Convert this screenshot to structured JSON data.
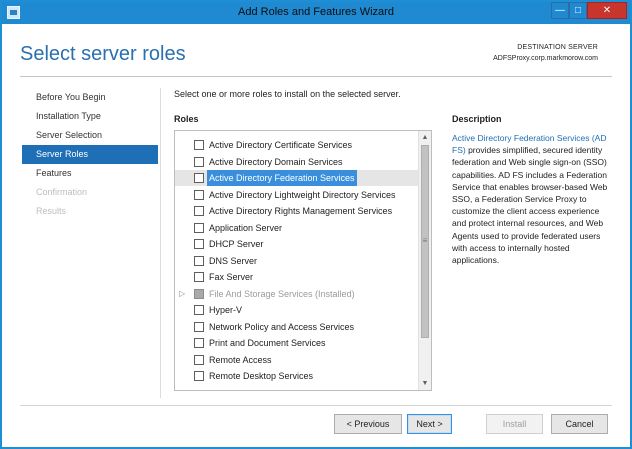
{
  "window": {
    "title": "Add Roles and Features Wizard",
    "controls": {
      "minimize": "—",
      "maximize": "□",
      "close": "✕"
    },
    "accent_color": "#1f8ad2"
  },
  "header": {
    "title": "Select server roles",
    "destination_label": "DESTINATION SERVER",
    "destination_server": "ADFSProxy.corp.markmorow.com"
  },
  "nav": {
    "items": [
      {
        "label": "Before You Begin",
        "state": "normal"
      },
      {
        "label": "Installation Type",
        "state": "normal"
      },
      {
        "label": "Server Selection",
        "state": "normal"
      },
      {
        "label": "Server Roles",
        "state": "active"
      },
      {
        "label": "Features",
        "state": "normal"
      },
      {
        "label": "Confirmation",
        "state": "disabled"
      },
      {
        "label": "Results",
        "state": "disabled"
      }
    ]
  },
  "main": {
    "instructions": "Select one or more roles to install on the selected server.",
    "roles_header": "Roles",
    "roles": [
      {
        "label": "Active Directory Certificate Services",
        "checked": false
      },
      {
        "label": "Active Directory Domain Services",
        "checked": false
      },
      {
        "label": "Active Directory Federation Services",
        "checked": false,
        "selected": true
      },
      {
        "label": "Active Directory Lightweight Directory Services",
        "checked": false
      },
      {
        "label": "Active Directory Rights Management Services",
        "checked": false
      },
      {
        "label": "Application Server",
        "checked": false
      },
      {
        "label": "DHCP Server",
        "checked": false
      },
      {
        "label": "DNS Server",
        "checked": false
      },
      {
        "label": "Fax Server",
        "checked": false
      },
      {
        "label": "File And Storage Services (Installed)",
        "checked": true,
        "installed": true,
        "expandable": true
      },
      {
        "label": "Hyper-V",
        "checked": false
      },
      {
        "label": "Network Policy and Access Services",
        "checked": false
      },
      {
        "label": "Print and Document Services",
        "checked": false
      },
      {
        "label": "Remote Access",
        "checked": false
      },
      {
        "label": "Remote Desktop Services",
        "checked": false
      }
    ],
    "scrollbar": {
      "up": "▲",
      "down": "▼",
      "grip": "≡"
    },
    "expander_glyph": "▷"
  },
  "description": {
    "header": "Description",
    "link_text": "Active Directory Federation Services (AD FS)",
    "body": " provides simplified, secured identity federation and Web single sign-on (SSO) capabilities. AD FS includes a Federation Service that enables browser-based Web SSO, a Federation Service Proxy to customize the client access experience and protect internal resources, and Web Agents used to provide federated users with access to internally hosted applications."
  },
  "footer": {
    "previous": "< Previous",
    "next": "Next >",
    "install": "Install",
    "cancel": "Cancel"
  },
  "colors": {
    "nav_active_bg": "#1f6fb6",
    "selection_bg": "#3a8fdd",
    "title_blue": "#2a6fb0"
  }
}
